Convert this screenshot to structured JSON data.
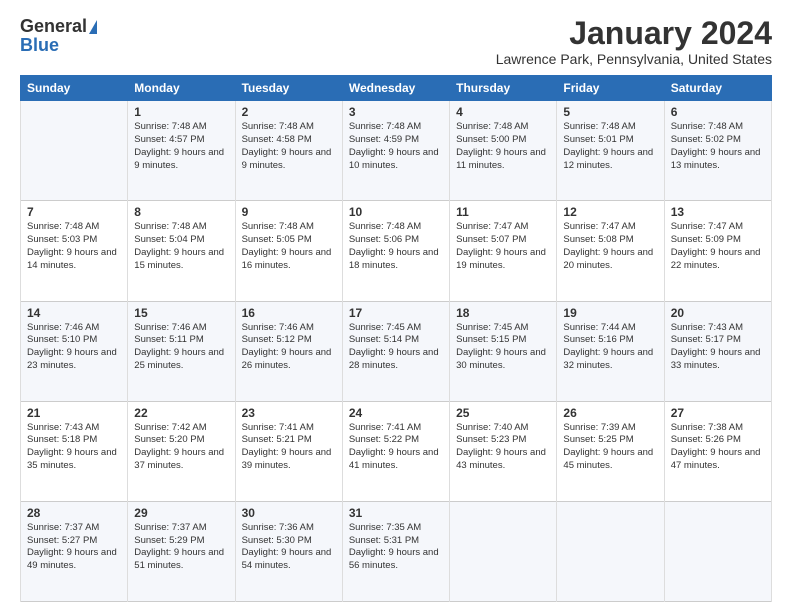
{
  "logo": {
    "general": "General",
    "blue": "Blue"
  },
  "header": {
    "month": "January 2024",
    "location": "Lawrence Park, Pennsylvania, United States"
  },
  "weekdays": [
    "Sunday",
    "Monday",
    "Tuesday",
    "Wednesday",
    "Thursday",
    "Friday",
    "Saturday"
  ],
  "weeks": [
    [
      {
        "day": "",
        "sunrise": "",
        "sunset": "",
        "daylight": ""
      },
      {
        "day": "1",
        "sunrise": "Sunrise: 7:48 AM",
        "sunset": "Sunset: 4:57 PM",
        "daylight": "Daylight: 9 hours and 9 minutes."
      },
      {
        "day": "2",
        "sunrise": "Sunrise: 7:48 AM",
        "sunset": "Sunset: 4:58 PM",
        "daylight": "Daylight: 9 hours and 9 minutes."
      },
      {
        "day": "3",
        "sunrise": "Sunrise: 7:48 AM",
        "sunset": "Sunset: 4:59 PM",
        "daylight": "Daylight: 9 hours and 10 minutes."
      },
      {
        "day": "4",
        "sunrise": "Sunrise: 7:48 AM",
        "sunset": "Sunset: 5:00 PM",
        "daylight": "Daylight: 9 hours and 11 minutes."
      },
      {
        "day": "5",
        "sunrise": "Sunrise: 7:48 AM",
        "sunset": "Sunset: 5:01 PM",
        "daylight": "Daylight: 9 hours and 12 minutes."
      },
      {
        "day": "6",
        "sunrise": "Sunrise: 7:48 AM",
        "sunset": "Sunset: 5:02 PM",
        "daylight": "Daylight: 9 hours and 13 minutes."
      }
    ],
    [
      {
        "day": "7",
        "sunrise": "Sunrise: 7:48 AM",
        "sunset": "Sunset: 5:03 PM",
        "daylight": "Daylight: 9 hours and 14 minutes."
      },
      {
        "day": "8",
        "sunrise": "Sunrise: 7:48 AM",
        "sunset": "Sunset: 5:04 PM",
        "daylight": "Daylight: 9 hours and 15 minutes."
      },
      {
        "day": "9",
        "sunrise": "Sunrise: 7:48 AM",
        "sunset": "Sunset: 5:05 PM",
        "daylight": "Daylight: 9 hours and 16 minutes."
      },
      {
        "day": "10",
        "sunrise": "Sunrise: 7:48 AM",
        "sunset": "Sunset: 5:06 PM",
        "daylight": "Daylight: 9 hours and 18 minutes."
      },
      {
        "day": "11",
        "sunrise": "Sunrise: 7:47 AM",
        "sunset": "Sunset: 5:07 PM",
        "daylight": "Daylight: 9 hours and 19 minutes."
      },
      {
        "day": "12",
        "sunrise": "Sunrise: 7:47 AM",
        "sunset": "Sunset: 5:08 PM",
        "daylight": "Daylight: 9 hours and 20 minutes."
      },
      {
        "day": "13",
        "sunrise": "Sunrise: 7:47 AM",
        "sunset": "Sunset: 5:09 PM",
        "daylight": "Daylight: 9 hours and 22 minutes."
      }
    ],
    [
      {
        "day": "14",
        "sunrise": "Sunrise: 7:46 AM",
        "sunset": "Sunset: 5:10 PM",
        "daylight": "Daylight: 9 hours and 23 minutes."
      },
      {
        "day": "15",
        "sunrise": "Sunrise: 7:46 AM",
        "sunset": "Sunset: 5:11 PM",
        "daylight": "Daylight: 9 hours and 25 minutes."
      },
      {
        "day": "16",
        "sunrise": "Sunrise: 7:46 AM",
        "sunset": "Sunset: 5:12 PM",
        "daylight": "Daylight: 9 hours and 26 minutes."
      },
      {
        "day": "17",
        "sunrise": "Sunrise: 7:45 AM",
        "sunset": "Sunset: 5:14 PM",
        "daylight": "Daylight: 9 hours and 28 minutes."
      },
      {
        "day": "18",
        "sunrise": "Sunrise: 7:45 AM",
        "sunset": "Sunset: 5:15 PM",
        "daylight": "Daylight: 9 hours and 30 minutes."
      },
      {
        "day": "19",
        "sunrise": "Sunrise: 7:44 AM",
        "sunset": "Sunset: 5:16 PM",
        "daylight": "Daylight: 9 hours and 32 minutes."
      },
      {
        "day": "20",
        "sunrise": "Sunrise: 7:43 AM",
        "sunset": "Sunset: 5:17 PM",
        "daylight": "Daylight: 9 hours and 33 minutes."
      }
    ],
    [
      {
        "day": "21",
        "sunrise": "Sunrise: 7:43 AM",
        "sunset": "Sunset: 5:18 PM",
        "daylight": "Daylight: 9 hours and 35 minutes."
      },
      {
        "day": "22",
        "sunrise": "Sunrise: 7:42 AM",
        "sunset": "Sunset: 5:20 PM",
        "daylight": "Daylight: 9 hours and 37 minutes."
      },
      {
        "day": "23",
        "sunrise": "Sunrise: 7:41 AM",
        "sunset": "Sunset: 5:21 PM",
        "daylight": "Daylight: 9 hours and 39 minutes."
      },
      {
        "day": "24",
        "sunrise": "Sunrise: 7:41 AM",
        "sunset": "Sunset: 5:22 PM",
        "daylight": "Daylight: 9 hours and 41 minutes."
      },
      {
        "day": "25",
        "sunrise": "Sunrise: 7:40 AM",
        "sunset": "Sunset: 5:23 PM",
        "daylight": "Daylight: 9 hours and 43 minutes."
      },
      {
        "day": "26",
        "sunrise": "Sunrise: 7:39 AM",
        "sunset": "Sunset: 5:25 PM",
        "daylight": "Daylight: 9 hours and 45 minutes."
      },
      {
        "day": "27",
        "sunrise": "Sunrise: 7:38 AM",
        "sunset": "Sunset: 5:26 PM",
        "daylight": "Daylight: 9 hours and 47 minutes."
      }
    ],
    [
      {
        "day": "28",
        "sunrise": "Sunrise: 7:37 AM",
        "sunset": "Sunset: 5:27 PM",
        "daylight": "Daylight: 9 hours and 49 minutes."
      },
      {
        "day": "29",
        "sunrise": "Sunrise: 7:37 AM",
        "sunset": "Sunset: 5:29 PM",
        "daylight": "Daylight: 9 hours and 51 minutes."
      },
      {
        "day": "30",
        "sunrise": "Sunrise: 7:36 AM",
        "sunset": "Sunset: 5:30 PM",
        "daylight": "Daylight: 9 hours and 54 minutes."
      },
      {
        "day": "31",
        "sunrise": "Sunrise: 7:35 AM",
        "sunset": "Sunset: 5:31 PM",
        "daylight": "Daylight: 9 hours and 56 minutes."
      },
      {
        "day": "",
        "sunrise": "",
        "sunset": "",
        "daylight": ""
      },
      {
        "day": "",
        "sunrise": "",
        "sunset": "",
        "daylight": ""
      },
      {
        "day": "",
        "sunrise": "",
        "sunset": "",
        "daylight": ""
      }
    ]
  ]
}
